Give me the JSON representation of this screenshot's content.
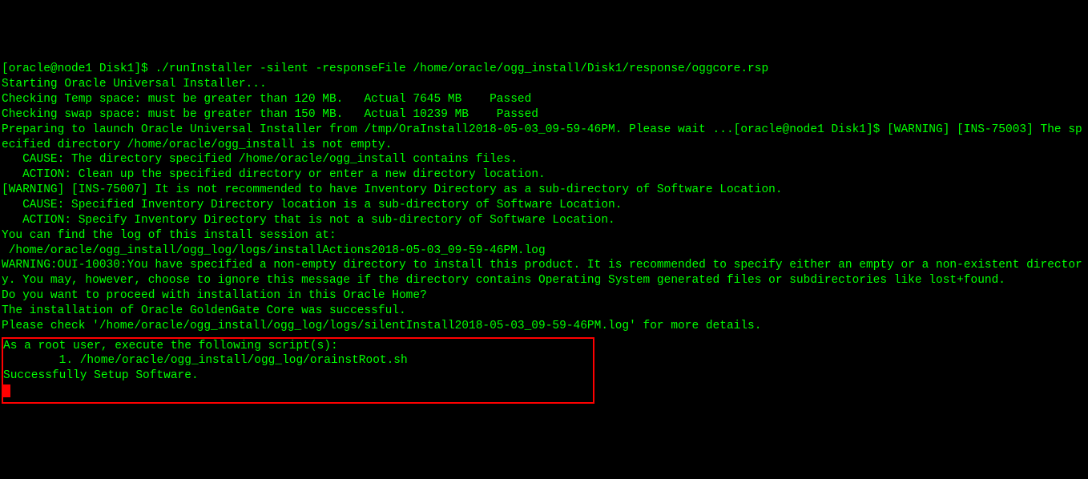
{
  "terminal": {
    "prompt_user_host": "[oracle@node1 Disk1]$ ",
    "command": "./runInstaller -silent -responseFile /home/oracle/ogg_install/Disk1/response/oggcore.rsp",
    "line_starting": "Starting Oracle Universal Installer...",
    "blank1": "",
    "line_temp": "Checking Temp space: must be greater than 120 MB.   Actual 7645 MB    Passed",
    "line_swap": "Checking swap space: must be greater than 150 MB.   Actual 10239 MB    Passed",
    "line_preparing": "Preparing to launch Oracle Universal Installer from /tmp/OraInstall2018-05-03_09-59-46PM. Please wait ...[oracle@node1 Disk1]$ [WARNING] [INS-75003] The specified directory /home/oracle/ogg_install is not empty.",
    "line_cause1": "   CAUSE: The directory specified /home/oracle/ogg_install contains files.",
    "line_action1": "   ACTION: Clean up the specified directory or enter a new directory location.",
    "line_warn2": "[WARNING] [INS-75007] It is not recommended to have Inventory Directory as a sub-directory of Software Location.",
    "line_cause2": "   CAUSE: Specified Inventory Directory location is a sub-directory of Software Location.",
    "line_action2": "   ACTION: Specify Inventory Directory that is not a sub-directory of Software Location.",
    "line_findlog": "You can find the log of this install session at:",
    "line_logpath": " /home/oracle/ogg_install/ogg_log/logs/installActions2018-05-03_09-59-46PM.log",
    "line_warn3": "WARNING:OUI-10030:You have specified a non-empty directory to install this product. It is recommended to specify either an empty or a non-existent directory. You may, however, choose to ignore this message if the directory contains Operating System generated files or subdirectories like lost+found.",
    "line_proceed": "Do you want to proceed with installation in this Oracle Home?",
    "line_success": "The installation of Oracle GoldenGate Core was successful.",
    "line_check": "Please check '/home/oracle/ogg_install/ogg_log/logs/silentInstall2018-05-03_09-59-46PM.log' for more details.",
    "box": {
      "line_root": "As a root user, execute the following script(s):",
      "line_script": "        1. /home/oracle/ogg_install/ogg_log/orainstRoot.sh",
      "blank_a": "",
      "blank_b": "",
      "blank_c": "",
      "line_setup": "Successfully Setup Software."
    }
  }
}
